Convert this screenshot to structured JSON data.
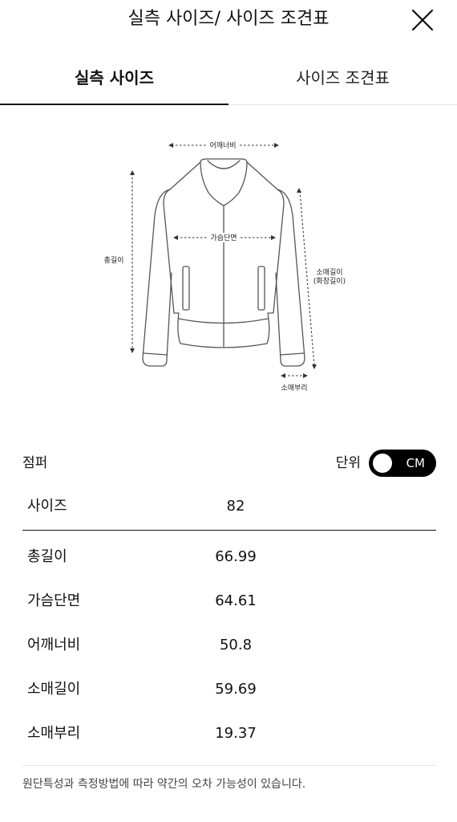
{
  "header": {
    "title": "실측 사이즈/ 사이즈 조견표",
    "close_icon": "close-icon"
  },
  "tabs": [
    {
      "label": "실측 사이즈",
      "active": true
    },
    {
      "label": "사이즈 조견표",
      "active": false
    }
  ],
  "diagram": {
    "labels": {
      "shoulder": "어깨너비",
      "chest": "가슴단면",
      "total_length": "총길이",
      "sleeve_length": "소매길이",
      "sleeve_length_alt": "(화장길이)",
      "sleeve_hem": "소매부리"
    }
  },
  "product": {
    "name": "점퍼",
    "unit_label": "단위",
    "unit_value": "CM"
  },
  "table": {
    "header": {
      "label": "사이즈",
      "value": "82"
    },
    "rows": [
      {
        "label": "총길이",
        "value": "66.99"
      },
      {
        "label": "가슴단면",
        "value": "64.61"
      },
      {
        "label": "어깨너비",
        "value": "50.8"
      },
      {
        "label": "소매길이",
        "value": "59.69"
      },
      {
        "label": "소매부리",
        "value": "19.37"
      }
    ]
  },
  "footer": {
    "note": "원단특성과 측정방법에 따라 약간의 오차 가능성이 있습니다."
  },
  "colors": {
    "text": "#111111",
    "toggle_bg": "#000000",
    "divider": "#e3e3e3"
  }
}
